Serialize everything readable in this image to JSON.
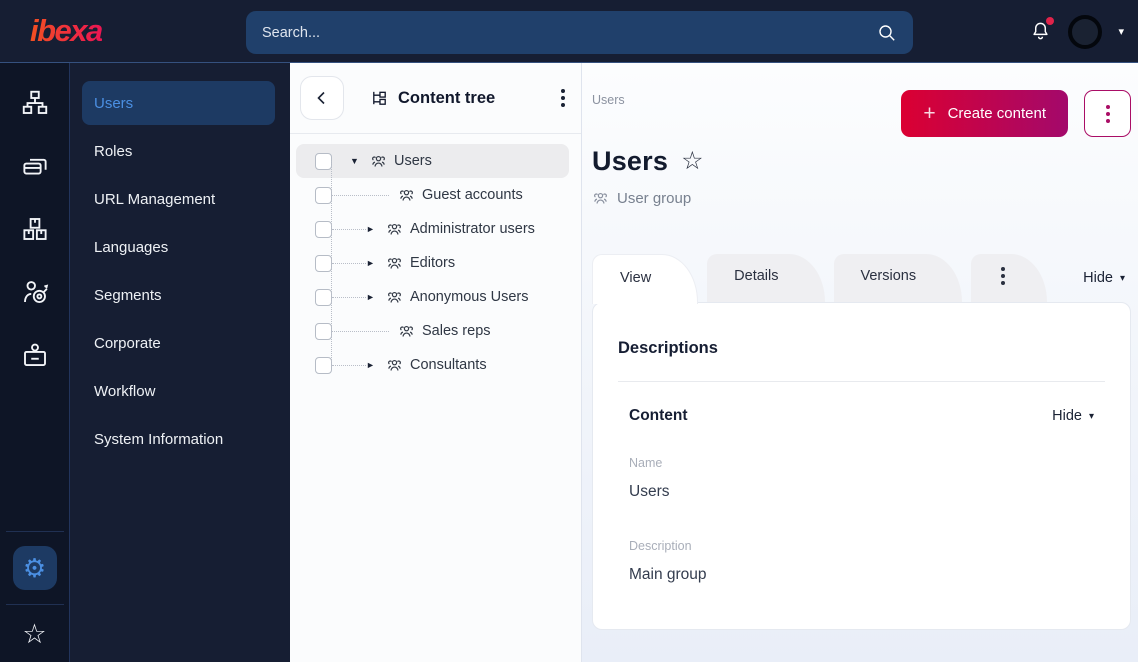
{
  "topbar": {
    "logo_text": "ibexa",
    "search": {
      "placeholder": "Search..."
    }
  },
  "icon_rail": {
    "items": [
      {
        "name": "content-structure"
      },
      {
        "name": "pages-design"
      },
      {
        "name": "commerce-packages"
      },
      {
        "name": "personalization-target"
      },
      {
        "name": "admin-badge"
      }
    ],
    "settings": {
      "name": "settings-gear",
      "active": true
    },
    "bookmarks": {
      "name": "bookmarks-star"
    }
  },
  "sidebar": {
    "items": [
      {
        "label": "Users",
        "active": true
      },
      {
        "label": "Roles"
      },
      {
        "label": "URL Management"
      },
      {
        "label": "Languages"
      },
      {
        "label": "Segments"
      },
      {
        "label": "Corporate"
      },
      {
        "label": "Workflow"
      },
      {
        "label": "System Information"
      }
    ]
  },
  "content_tree": {
    "title": "Content tree",
    "items": [
      {
        "label": "Users",
        "state": "expanded",
        "selected": true,
        "depth": 0
      },
      {
        "label": "Guest accounts",
        "state": "leaf",
        "depth": 1
      },
      {
        "label": "Administrator users",
        "state": "collapsed",
        "depth": 1
      },
      {
        "label": "Editors",
        "state": "collapsed",
        "depth": 1
      },
      {
        "label": "Anonymous Users",
        "state": "collapsed",
        "depth": 1
      },
      {
        "label": "Sales reps",
        "state": "leaf",
        "depth": 1
      },
      {
        "label": "Consultants",
        "state": "collapsed",
        "depth": 1
      }
    ]
  },
  "main": {
    "breadcrumb": "Users",
    "actions": {
      "create_label": "Create content"
    },
    "title": "Users",
    "content_type": "User group",
    "tabs": [
      {
        "label": "View",
        "active": true
      },
      {
        "label": "Details"
      },
      {
        "label": "Versions"
      }
    ],
    "hide_label": "Hide",
    "card": {
      "descriptions_heading": "Descriptions",
      "content_section": {
        "heading": "Content",
        "hide_label": "Hide",
        "fields": [
          {
            "label": "Name",
            "value": "Users"
          },
          {
            "label": "Description",
            "value": "Main group"
          }
        ]
      }
    }
  },
  "icons": {
    "plus": "+",
    "caret_down": "▾",
    "tree_expanded": "▼",
    "tree_collapsed": "►",
    "star": "☆",
    "gear": "⚙"
  },
  "colors": {
    "topbar_bg": "#161e33",
    "rail_bg": "#0e1526",
    "accent_red": "#db0032",
    "accent_magenta": "#a3096b",
    "selected_blue": "#4b8fe2",
    "selected_pill_bg": "#1d3a63",
    "notification_dot": "#e0234a"
  }
}
